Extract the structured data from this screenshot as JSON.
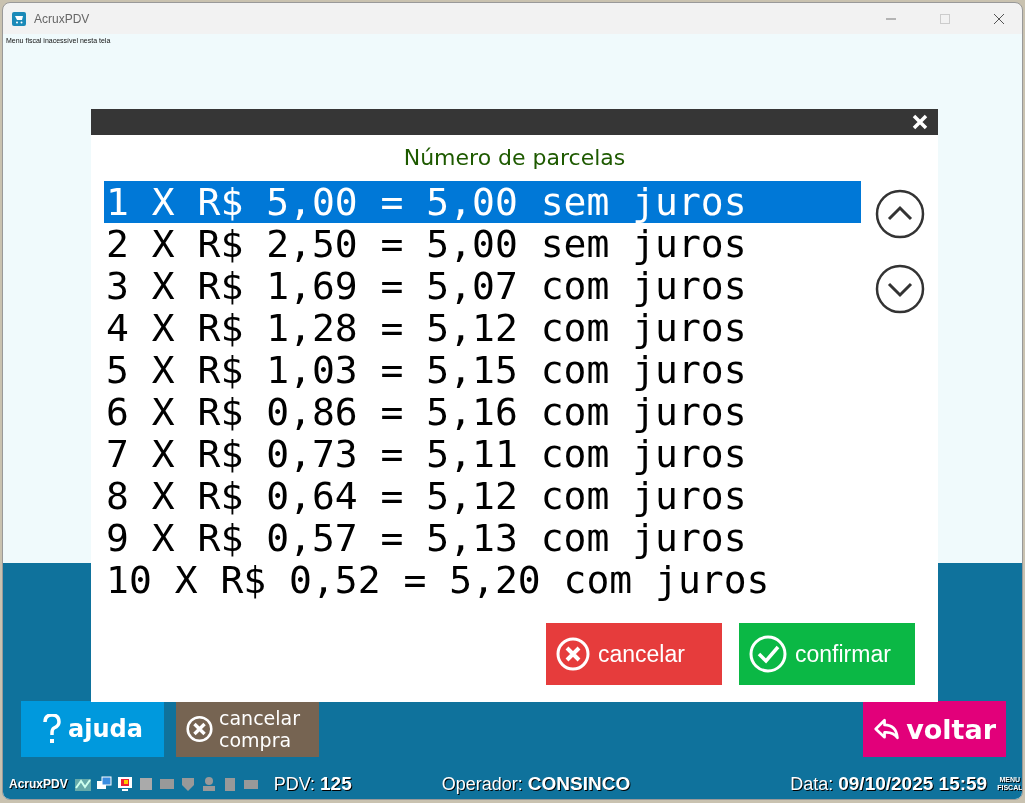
{
  "window": {
    "title": "AcruxPDV",
    "notice": "Menu fiscal inacessível nesta tela"
  },
  "dialog": {
    "title": "Número de parcelas",
    "options": [
      {
        "label": "1 X R$ 5,00 = 5,00 sem juros",
        "selected": true
      },
      {
        "label": "2 X R$ 2,50 = 5,00 sem juros",
        "selected": false
      },
      {
        "label": "3 X R$ 1,69 = 5,07 com juros",
        "selected": false
      },
      {
        "label": "4 X R$ 1,28 = 5,12 com juros",
        "selected": false
      },
      {
        "label": "5 X R$ 1,03 = 5,15 com juros",
        "selected": false
      },
      {
        "label": "6 X R$ 0,86 = 5,16 com juros",
        "selected": false
      },
      {
        "label": "7 X R$ 0,73 = 5,11 com juros",
        "selected": false
      },
      {
        "label": "8 X R$ 0,64 = 5,12 com juros",
        "selected": false
      },
      {
        "label": "9 X R$ 0,57 = 5,13 com juros",
        "selected": false
      },
      {
        "label": "10 X R$ 0,52 = 5,20 com juros",
        "selected": false
      }
    ],
    "buttons": [
      {
        "kind": "cancel",
        "label": "cancelar"
      },
      {
        "kind": "confirm",
        "label": "confirmar"
      }
    ]
  },
  "actions": [
    {
      "kind": "help",
      "label": "ajuda"
    },
    {
      "kind": "cancel",
      "label": "cancelar compra"
    },
    {
      "kind": "back",
      "label": "voltar"
    }
  ],
  "status_bar": {
    "app": "AcruxPDV",
    "pdv_label": "PDV:",
    "pdv": "125",
    "operator_label": "Operador:",
    "operator": "CONSINCO",
    "date_label": "Data:",
    "date": "09/10/2025 15:59",
    "menu": [
      "MENU",
      "FISCAL"
    ]
  }
}
